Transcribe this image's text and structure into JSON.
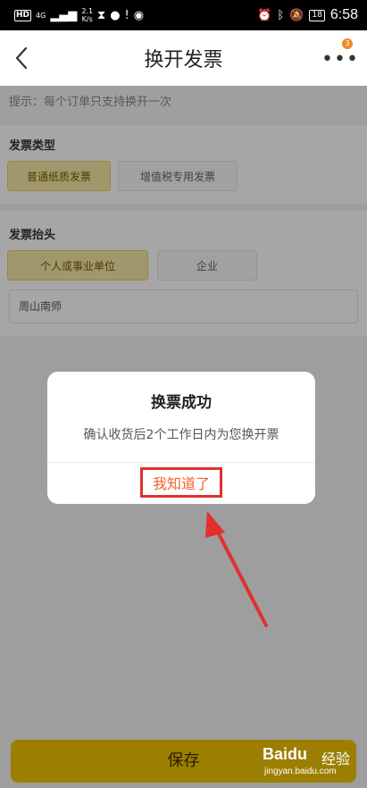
{
  "status_bar": {
    "hd": "HD",
    "network": "4G",
    "speed_value": "2.1",
    "speed_unit": "K/s",
    "battery": "18",
    "time": "6:58"
  },
  "nav": {
    "title": "换开发票",
    "badge": "3",
    "icons": [
      "back-chevron-icon",
      "more-dots-icon"
    ]
  },
  "hint": "提示：每个订单只支持换开一次",
  "invoice_type": {
    "label": "发票类型",
    "options": [
      "普通纸质发票",
      "增值税专用发票"
    ],
    "selected_index": 0
  },
  "invoice_head": {
    "label": "发票抬头",
    "options": [
      "个人或事业单位",
      "企业"
    ],
    "selected_index": 0,
    "field_value": "周山南师"
  },
  "dialog": {
    "title": "换票成功",
    "message": "确认收货后2个工作日内为您换开票",
    "confirm_label": "我知道了"
  },
  "save_label": "保存",
  "watermark": {
    "brand": "Baidu",
    "brand_cn": "经验",
    "url": "jingyan.baidu.com"
  },
  "colors": {
    "accent": "#f0c400",
    "dialog_confirm": "#f0642b",
    "annotation": "#e03030"
  }
}
